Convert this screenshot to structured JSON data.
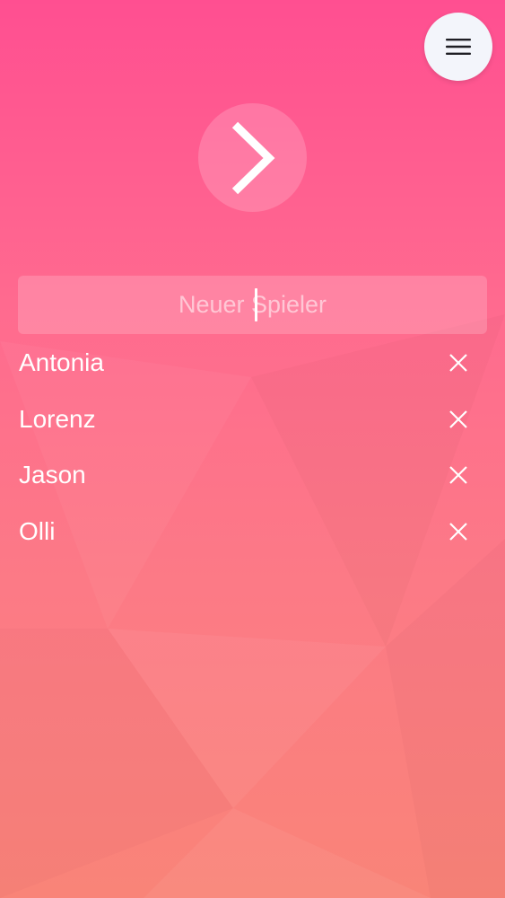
{
  "menu": {
    "icon": "hamburger-menu-icon"
  },
  "next": {
    "icon": "chevron-right-icon"
  },
  "new_player": {
    "placeholder": "Neuer Spieler",
    "value": ""
  },
  "players": [
    {
      "name": "Antonia",
      "remove_icon": "close-icon"
    },
    {
      "name": "Lorenz",
      "remove_icon": "close-icon"
    },
    {
      "name": "Jason",
      "remove_icon": "close-icon"
    },
    {
      "name": "Olli",
      "remove_icon": "close-icon"
    }
  ],
  "colors": {
    "gradient_top": "#ff4f91",
    "gradient_bottom": "#f98478",
    "menu_button_bg": "#f3f5fb",
    "text": "#ffffff"
  }
}
